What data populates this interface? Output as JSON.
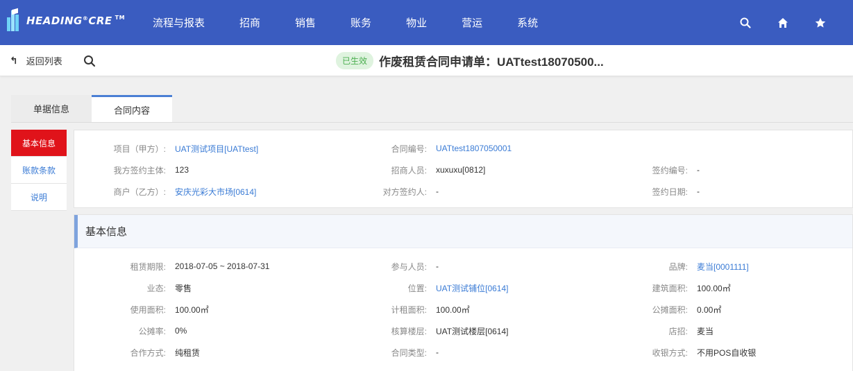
{
  "app": {
    "logo_text": "HEADING",
    "logo_reg": "®",
    "logo_text2": "CRE",
    "logo_tm": "TM"
  },
  "nav": {
    "items": [
      "流程与报表",
      "招商",
      "销售",
      "账务",
      "物业",
      "营运",
      "系统"
    ],
    "icons": [
      "search-icon",
      "home-icon",
      "star-icon"
    ]
  },
  "subheader": {
    "back_label": "返回列表",
    "status_badge": "已生效",
    "title": "作废租赁合同申请单：UATtest18070500..."
  },
  "tabs": [
    {
      "label": "单据信息",
      "active": false
    },
    {
      "label": "合同内容",
      "active": true
    }
  ],
  "side_menu": [
    {
      "label": "基本信息",
      "active": true
    },
    {
      "label": "账款条款",
      "active": false
    },
    {
      "label": "说明",
      "active": false
    }
  ],
  "summary": {
    "project": {
      "label": "项目（甲方）:",
      "value": "UAT测试项目[UATtest]"
    },
    "contract_no": {
      "label": "合同编号:",
      "value": "UATtest1807050001"
    },
    "our_party": {
      "label": "我方签约主体:",
      "value": "123"
    },
    "recruiter": {
      "label": "招商人员:",
      "value": "xuxuxu[0812]"
    },
    "sign_no": {
      "label": "签约编号:",
      "value": "-"
    },
    "tenant": {
      "label": "商户（乙方）:",
      "value": "安庆光彩大市场[0614]"
    },
    "counter_signer": {
      "label": "对方签约人:",
      "value": "-"
    },
    "sign_date": {
      "label": "签约日期:",
      "value": "-"
    }
  },
  "basic_info": {
    "heading": "基本信息",
    "lease_term": {
      "label": "租赁期限:",
      "value": "2018-07-05 ~ 2018-07-31"
    },
    "participants": {
      "label": "参与人员:",
      "value": "-"
    },
    "brand": {
      "label": "品牌:",
      "value": "麦当[0001111]"
    },
    "business_type": {
      "label": "业态:",
      "value": "零售"
    },
    "location": {
      "label": "位置:",
      "value": "UAT测试铺位[0614]"
    },
    "building_area": {
      "label": "建筑面积:",
      "value": "100.00㎡"
    },
    "usable_area": {
      "label": "使用面积:",
      "value": "100.00㎡"
    },
    "rent_area": {
      "label": "计租面积:",
      "value": "100.00㎡"
    },
    "shared_area": {
      "label": "公摊面积:",
      "value": "0.00㎡"
    },
    "shared_rate": {
      "label": "公摊率:",
      "value": "0%"
    },
    "floor": {
      "label": "核算楼层:",
      "value": "UAT测试楼层[0614]"
    },
    "shop_sign": {
      "label": "店招:",
      "value": "麦当"
    },
    "coop_mode": {
      "label": "合作方式:",
      "value": "纯租赁"
    },
    "contract_type": {
      "label": "合同类型:",
      "value": "-"
    },
    "cashier_mode": {
      "label": "收银方式:",
      "value": "不用POS自收银"
    }
  },
  "colors": {
    "nav_bg": "#3a5cc0",
    "accent_red": "#e0131a",
    "link_blue": "#3a7bd5",
    "badge_green": "#4caf50"
  }
}
